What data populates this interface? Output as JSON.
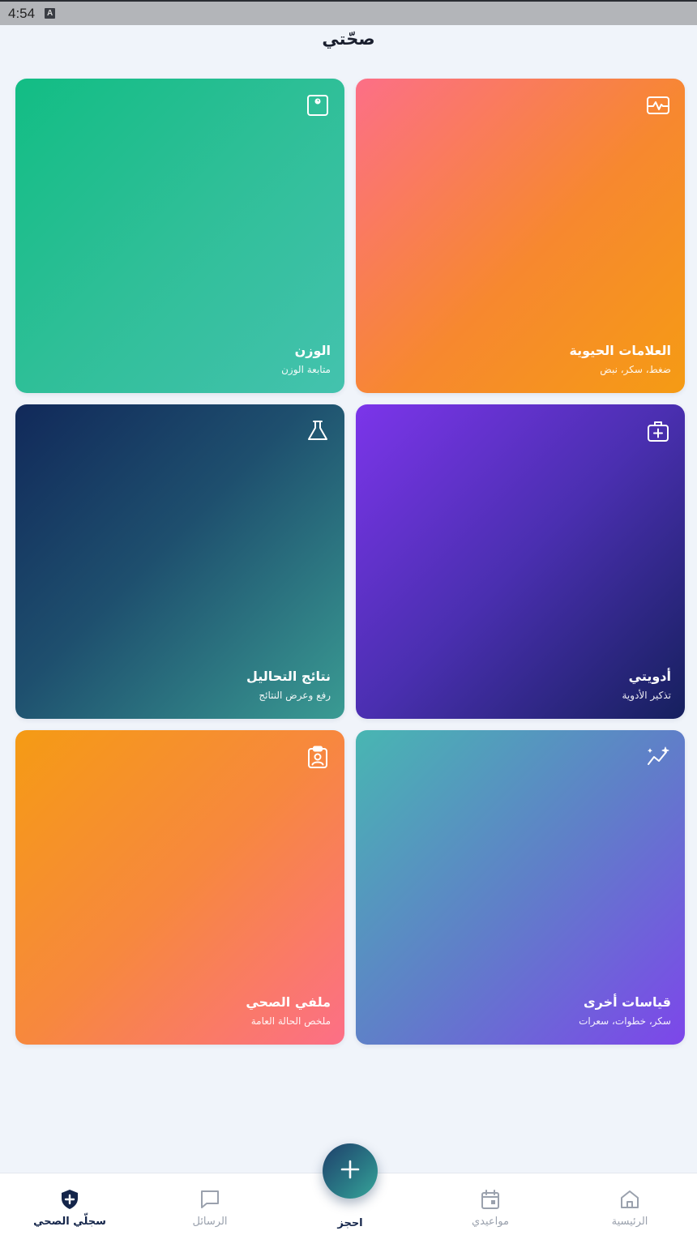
{
  "status_bar": {
    "time": "4:54",
    "indicator": "A"
  },
  "header": {
    "title": "صحّتي"
  },
  "cards": [
    {
      "title": "العلامات الحيوية",
      "subtitle": "ضغط، سكر، نبض",
      "icon": "vitals-monitor-icon"
    },
    {
      "title": "الوزن",
      "subtitle": "متابعة الوزن",
      "icon": "scale-icon"
    },
    {
      "title": "أدويتي",
      "subtitle": "تذكير الأدوية",
      "icon": "medical-kit-icon"
    },
    {
      "title": "نتائج التحاليل",
      "subtitle": "رفع وعرض النتائج",
      "icon": "lab-flask-icon"
    },
    {
      "title": "قياسات أخرى",
      "subtitle": "سكر، خطوات، سعرات",
      "icon": "trend-sparkle-icon"
    },
    {
      "title": "ملفي الصحي",
      "subtitle": "ملخص الحالة العامة",
      "icon": "clipboard-user-icon"
    }
  ],
  "bottom_nav": {
    "home": "الرئيسية",
    "appointments": "مواعيدي",
    "book": "احجز",
    "messages": "الرسائل",
    "health_record": "سجلّي الصحي"
  },
  "colors": {
    "background": "#f0f4fa",
    "active_nav": "#14254a",
    "inactive_nav": "#9aa1ad"
  }
}
